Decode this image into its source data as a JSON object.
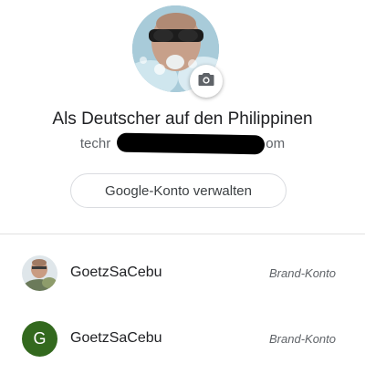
{
  "profile": {
    "name": "Als Deutscher auf den Philippinen",
    "email_prefix": "techr",
    "email_suffix": "om"
  },
  "manage_button_label": "Google-Konto verwalten",
  "accounts": [
    {
      "name": "GoetzSaCebu",
      "type": "Brand-Konto",
      "avatar": "photo"
    },
    {
      "name": "GoetzSaCebu",
      "type": "Brand-Konto",
      "avatar": "letter",
      "initial": "G",
      "color": "#33691e"
    }
  ],
  "icons": {
    "camera": "camera-icon"
  }
}
